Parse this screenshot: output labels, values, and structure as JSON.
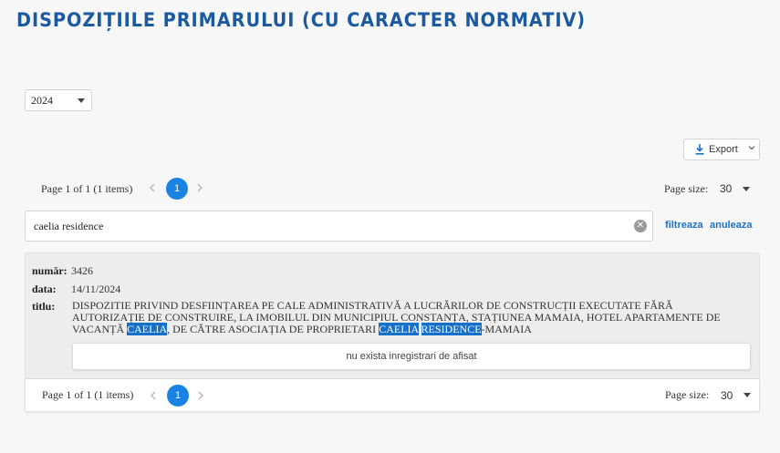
{
  "page": {
    "title": "DISPOZIȚIILE PRIMARULUI (CU CARACTER NORMATIV)"
  },
  "filters": {
    "year": "2024"
  },
  "toolbar": {
    "export_label": "Export"
  },
  "pager": {
    "info": "Page 1 of 1 (1 items)",
    "current_page": "1",
    "page_size_label": "Page size:",
    "page_size": "30"
  },
  "search": {
    "value": "caelia residence",
    "apply_label": "filtreaza",
    "cancel_label": "anuleaza"
  },
  "result": {
    "numar_label": "număr:",
    "numar": "3426",
    "data_label": "data:",
    "data": "14/11/2024",
    "titlu_label": "titlu:",
    "titlu_1": "DISPOZITIE PRIVIND DESFIINȚAREA PE CALE ADMINISTRATIVĂ A LUCRĂRILOR DE CONSTRUCȚII EXECUTATE FĂRĂ AUTORIZAȚIE DE CONSTRUIRE, LA IMOBILUL DIN MUNICIPIUL CONSTANȚA, STAȚIUNEA MAMAIA, HOTEL APARTAMENTE DE VACANȚĂ ",
    "titlu_hl_1": "CAELIA",
    "titlu_2": ", DE CĂTRE ASOCIAȚIA DE PROPRIETARI ",
    "titlu_hl_2": "CAELIA",
    "titlu_3": " ",
    "titlu_hl_3": "RESIDENCE",
    "titlu_4": "-MAMAIA",
    "no_records": "nu exista inregistrari de afisat"
  },
  "colors": {
    "accent": "#1a82e2",
    "title": "#1c5aa0",
    "highlight": "#1670c9",
    "link": "#1a73c8"
  }
}
